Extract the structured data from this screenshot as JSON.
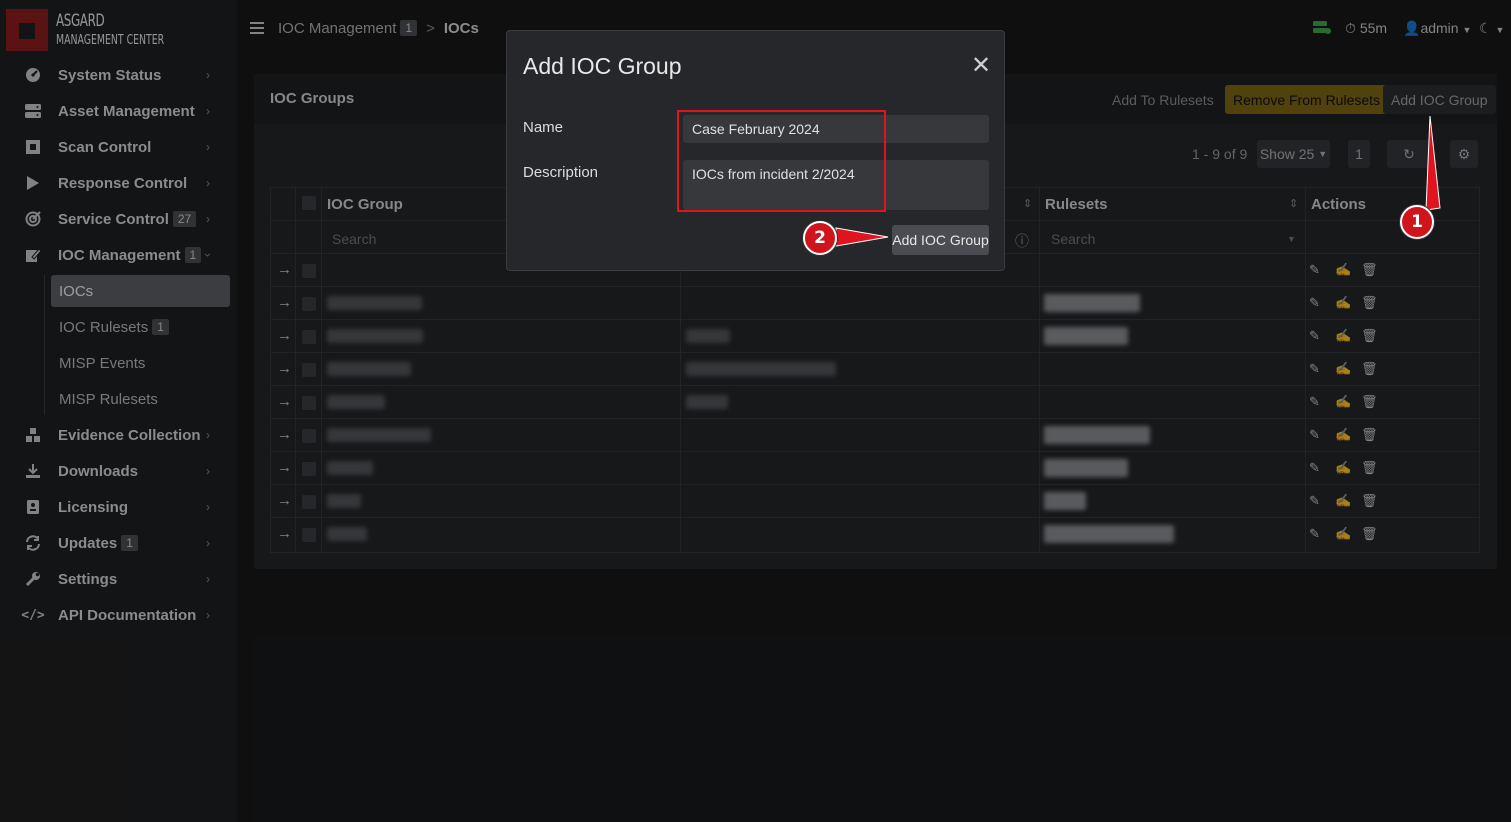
{
  "app": {
    "logo_title": "ASGARD",
    "logo_subtitle": "MANAGEMENT CENTER"
  },
  "sidebar": {
    "items": [
      {
        "label": "System Status",
        "icon": "gauge-icon"
      },
      {
        "label": "Asset Management",
        "icon": "server-icon"
      },
      {
        "label": "Scan Control",
        "icon": "scan-icon"
      },
      {
        "label": "Response Control",
        "icon": "play-icon"
      },
      {
        "label": "Service Control",
        "badge": "27",
        "icon": "target-icon"
      },
      {
        "label": "IOC Management",
        "badge": "1",
        "icon": "edit-icon"
      },
      {
        "label": "Evidence Collection",
        "icon": "boxes-icon"
      },
      {
        "label": "Downloads",
        "icon": "download-icon"
      },
      {
        "label": "Licensing",
        "icon": "license-icon"
      },
      {
        "label": "Updates",
        "badge": "1",
        "icon": "sync-icon"
      },
      {
        "label": "Settings",
        "icon": "wrench-icon"
      },
      {
        "label": "API Documentation",
        "icon": "code-icon"
      }
    ],
    "subitems": [
      {
        "label": "IOCs",
        "active": true
      },
      {
        "label": "IOC Rulesets",
        "badge": "1"
      },
      {
        "label": "MISP Events"
      },
      {
        "label": "MISP Rulesets"
      }
    ]
  },
  "topbar": {
    "breadcrumb_parent": "IOC Management",
    "breadcrumb_parent_badge": "1",
    "breadcrumb_sep": ">",
    "breadcrumb_current": "IOCs",
    "session_timer": "55m",
    "user": "admin"
  },
  "panel": {
    "title": "IOC Groups",
    "btn_add_to_rulesets": "Add To Rulesets",
    "btn_remove_from_rulesets": "Remove From Rulesets",
    "btn_add_ioc_group": "Add IOC Group",
    "pager_range": "1 - 9 of 9",
    "show_label": "Show 25",
    "page_number": "1"
  },
  "table": {
    "headers": {
      "ioc_group": "IOC Group",
      "rulesets": "Rulesets",
      "actions": "Actions"
    },
    "search_placeholder": "Search",
    "row_count": 9
  },
  "modal": {
    "title": "Add IOC Group",
    "name_label": "Name",
    "name_value": "Case February 2024",
    "description_label": "Description",
    "description_value": "IOCs from incident 2/2024",
    "submit_label": "Add IOC Group"
  },
  "annotations": {
    "callout_1": "1",
    "callout_2": "2"
  },
  "colors": {
    "accent_red": "#d0141c",
    "warn_button": "#7d6414",
    "background": "#17181a"
  }
}
